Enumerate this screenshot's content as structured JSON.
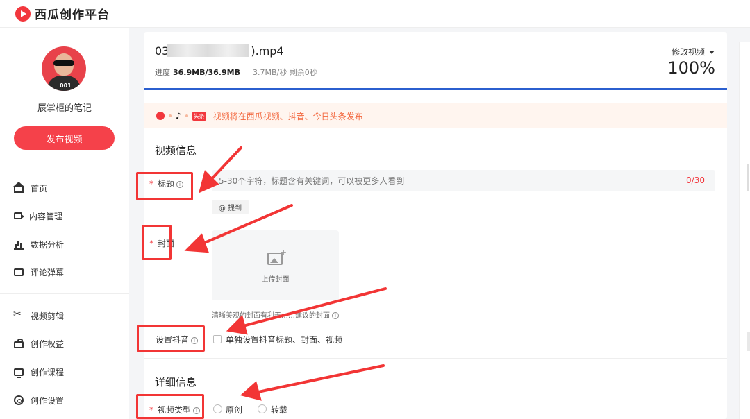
{
  "app": {
    "logo_text": "西瓜创作平台"
  },
  "sidebar": {
    "username": "辰掌柜的笔记",
    "avatar_shirt_text": "001",
    "publish_button": "发布视频",
    "nav_primary": [
      {
        "label": "首页",
        "icon": "home-icon"
      },
      {
        "label": "内容管理",
        "icon": "content-icon"
      },
      {
        "label": "数据分析",
        "icon": "data-analysis-icon"
      },
      {
        "label": "评论弹幕",
        "icon": "comment-icon"
      }
    ],
    "nav_secondary": [
      {
        "label": "视频剪辑",
        "icon": "scissors-icon"
      },
      {
        "label": "创作权益",
        "icon": "gift-icon"
      },
      {
        "label": "创作课程",
        "icon": "course-icon"
      },
      {
        "label": "创作设置",
        "icon": "settings-icon"
      }
    ]
  },
  "upload": {
    "file_prefix": "03",
    "file_suffix": ").mp4",
    "progress_label": "进度",
    "progress_value": "36.9MB/36.9MB",
    "speed": "3.7MB/秒",
    "remaining": "剩余0秒",
    "modify_label": "修改视频",
    "percent_text": "100%",
    "progress_fraction": 1.0
  },
  "notice": {
    "tag_label": "头条",
    "text": "视频将在西瓜视频、抖音、今日头条发布"
  },
  "video_info": {
    "section_title": "视频信息",
    "title_label": "标题",
    "title_placeholder": "5-30个字符，标题含有关键词，可以被更多人看到",
    "title_counter": "0/30",
    "mention_button": "@ 提到",
    "cover_label": "封面",
    "cover_upload_text": "上传封面",
    "cover_hint": "清晰美观的封面有利于……建议的封面",
    "douyin_label": "设置抖音",
    "douyin_checkbox_text": "单独设置抖音标题、封面、视频"
  },
  "details": {
    "section_title": "详细信息",
    "type_label": "视频类型",
    "options": [
      "原创",
      "转载"
    ]
  },
  "colors": {
    "accent": "#f5414a",
    "progress": "#2b5fcf",
    "annotation": "#f23535",
    "notice_text": "#f3683f"
  }
}
